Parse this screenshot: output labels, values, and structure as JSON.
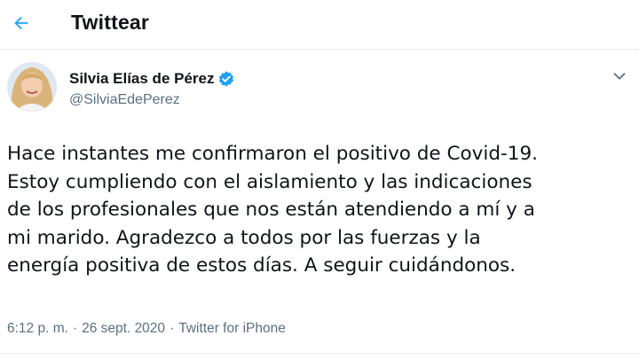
{
  "header": {
    "title": "Twittear",
    "back_icon": "arrow-left-icon",
    "accent_color": "#1da1f2"
  },
  "author": {
    "name": "Silvia Elías de Pérez",
    "handle": "@SilviaEdePerez",
    "verified": true,
    "verified_icon": "verified-badge-icon",
    "verified_color": "#1da1f2",
    "more_icon": "more-icon"
  },
  "tweet": {
    "lines": [
      "Hace instantes me confirmaron el positivo de Covid-19.",
      "Estoy cumpliendo con el aislamiento y las indicaciones",
      "de los profesionales que nos están atendiendo a mí y a",
      "mi marido. Agradezco a todos por las fuerzas y la",
      "energía positiva de estos días. A seguir cuidándonos."
    ],
    "time": "6:12 p. m.",
    "separator": "·",
    "date": "26 sept. 2020",
    "source": "Twitter for iPhone"
  }
}
